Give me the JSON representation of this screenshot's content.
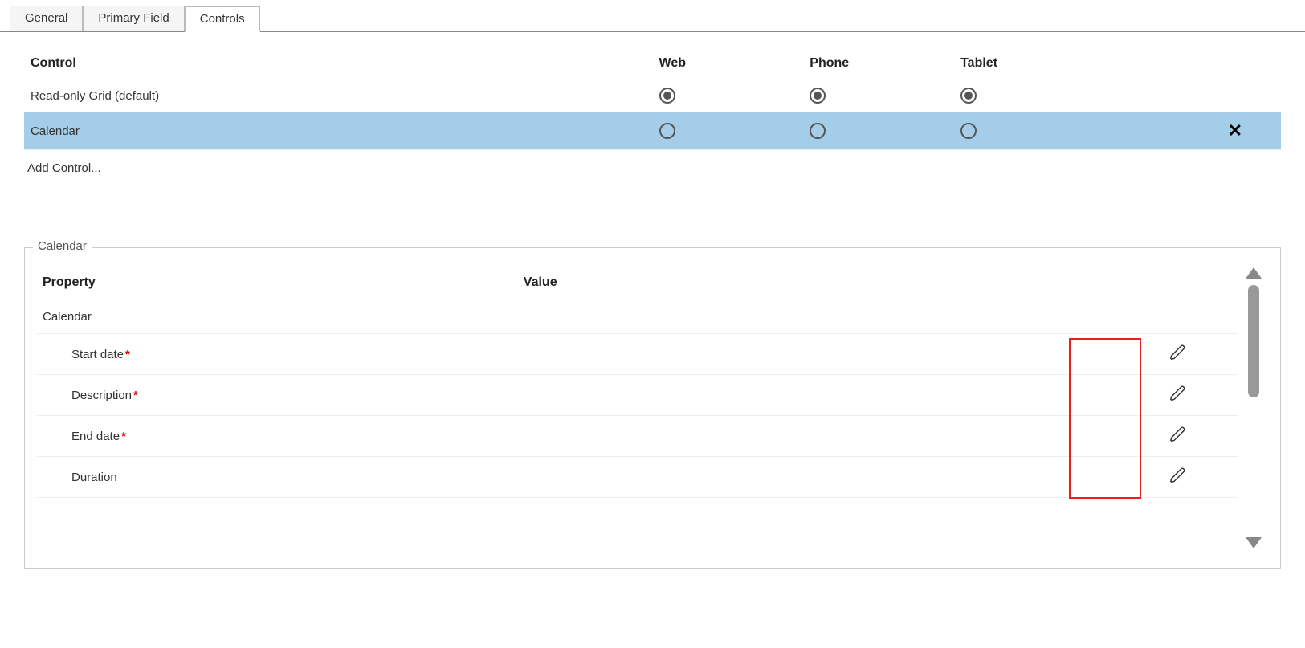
{
  "tabs": {
    "items": [
      {
        "label": "General",
        "active": false
      },
      {
        "label": "Primary Field",
        "active": false
      },
      {
        "label": "Controls",
        "active": true
      }
    ]
  },
  "controls_table": {
    "headers": {
      "control": "Control",
      "web": "Web",
      "phone": "Phone",
      "tablet": "Tablet"
    },
    "rows": [
      {
        "name": "Read-only Grid (default)",
        "web": true,
        "phone": true,
        "tablet": true,
        "selected": false,
        "removable": false
      },
      {
        "name": "Calendar",
        "web": false,
        "phone": false,
        "tablet": false,
        "selected": true,
        "removable": true
      }
    ],
    "add_link": "Add Control..."
  },
  "properties_panel": {
    "legend": "Calendar",
    "headers": {
      "property": "Property",
      "value": "Value"
    },
    "group_label": "Calendar",
    "rows": [
      {
        "label": "Start date",
        "required": true,
        "value": "",
        "editable": true
      },
      {
        "label": "Description",
        "required": true,
        "value": "",
        "editable": true
      },
      {
        "label": "End date",
        "required": true,
        "value": "",
        "editable": true
      },
      {
        "label": "Duration",
        "required": false,
        "value": "",
        "editable": true
      }
    ]
  }
}
